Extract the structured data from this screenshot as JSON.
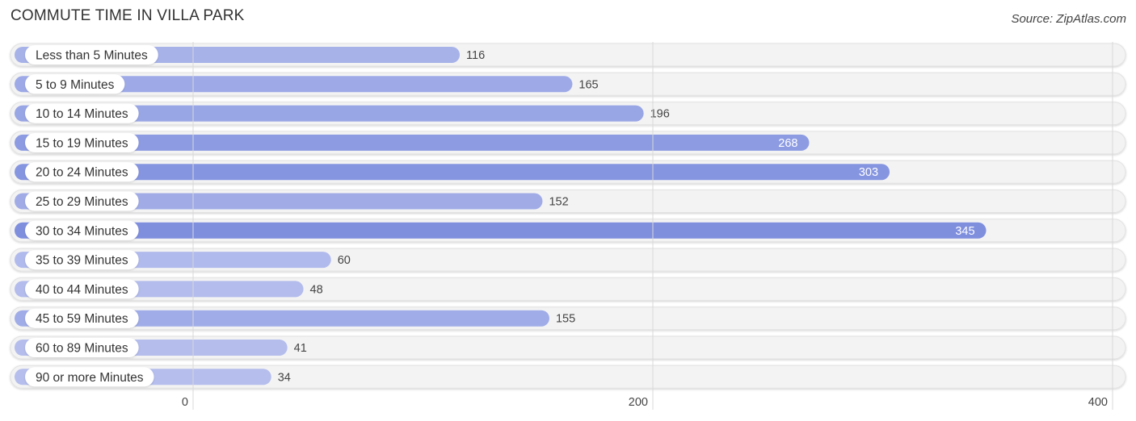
{
  "header": {
    "title": "COMMUTE TIME IN VILLA PARK",
    "source": "Source: ZipAtlas.com"
  },
  "chart_data": {
    "type": "bar",
    "orientation": "horizontal",
    "title": "COMMUTE TIME IN VILLA PARK",
    "xlabel": "",
    "ylabel": "",
    "categories": [
      "Less than 5 Minutes",
      "5 to 9 Minutes",
      "10 to 14 Minutes",
      "15 to 19 Minutes",
      "20 to 24 Minutes",
      "25 to 29 Minutes",
      "30 to 34 Minutes",
      "35 to 39 Minutes",
      "40 to 44 Minutes",
      "45 to 59 Minutes",
      "60 to 89 Minutes",
      "90 or more Minutes"
    ],
    "values": [
      116,
      165,
      196,
      268,
      303,
      152,
      345,
      60,
      48,
      155,
      41,
      34
    ],
    "xlim": [
      0,
      400
    ],
    "xticks": [
      0,
      200,
      400
    ],
    "xtick_labels": [
      "0",
      "200",
      "400"
    ],
    "grid": true,
    "legend": "none",
    "colors": {
      "bar_light": "#b4bdec",
      "bar_mid": "#a2aee6",
      "bar_dark": "#7f8fde",
      "track": "#f2f2f2",
      "grid": "#dddddd"
    }
  }
}
